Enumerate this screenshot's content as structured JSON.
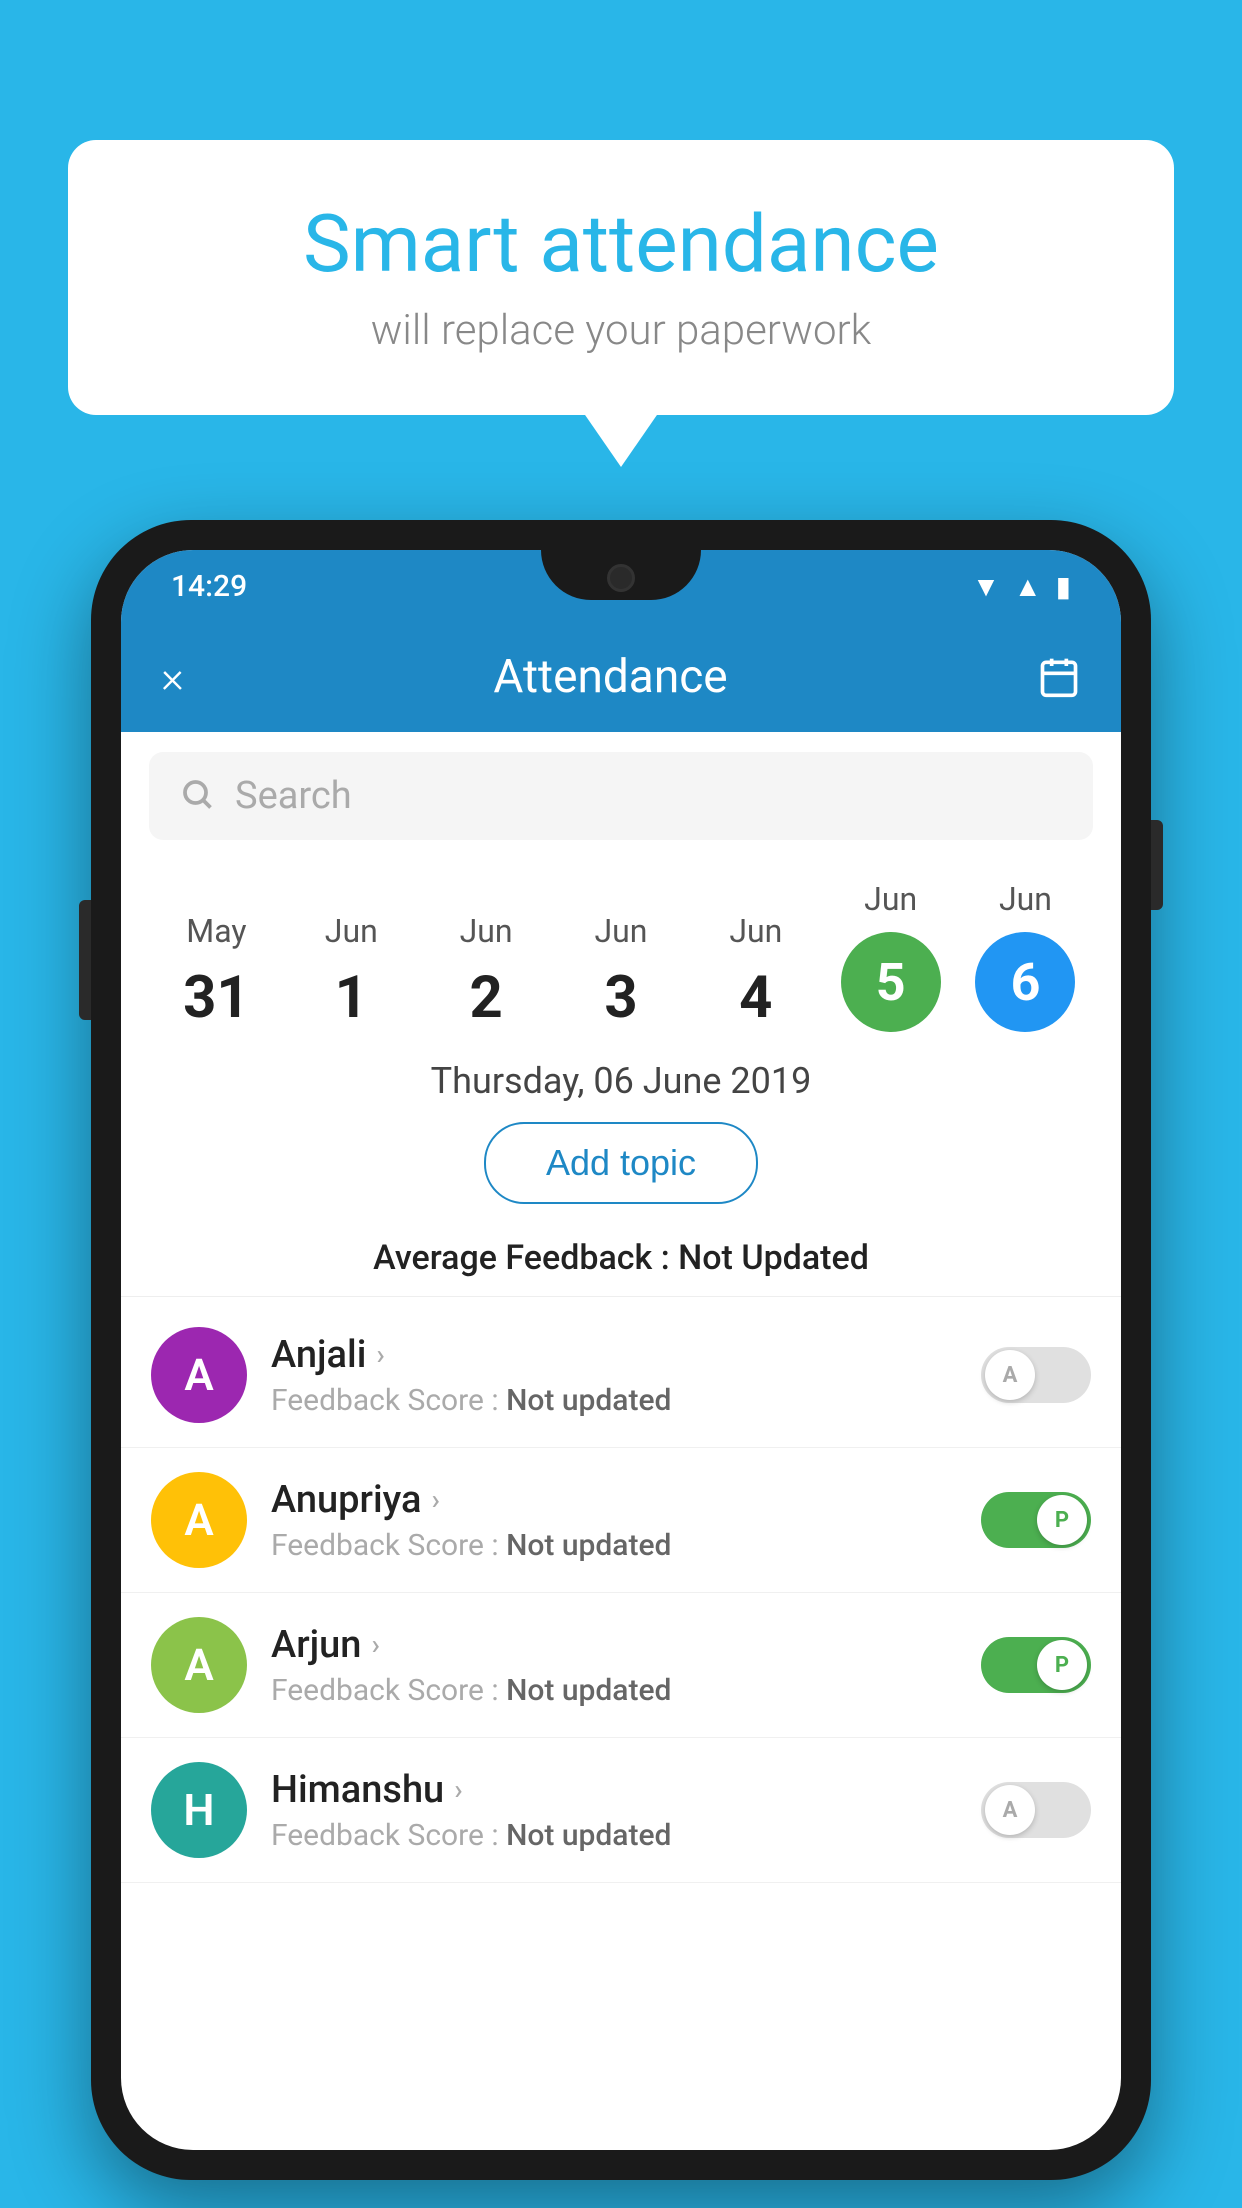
{
  "background_color": "#29b6e8",
  "bubble": {
    "title": "Smart attendance",
    "subtitle": "will replace your paperwork"
  },
  "status_bar": {
    "time": "14:29",
    "wifi": "▼",
    "signal": "▲",
    "battery": "▮"
  },
  "app_bar": {
    "close_label": "×",
    "title": "Attendance",
    "calendar_icon": "calendar-icon"
  },
  "search": {
    "placeholder": "Search"
  },
  "dates": [
    {
      "month": "May",
      "day": "31",
      "selected": false
    },
    {
      "month": "Jun",
      "day": "1",
      "selected": false
    },
    {
      "month": "Jun",
      "day": "2",
      "selected": false
    },
    {
      "month": "Jun",
      "day": "3",
      "selected": false
    },
    {
      "month": "Jun",
      "day": "4",
      "selected": false
    },
    {
      "month": "Jun",
      "day": "5",
      "selected": "green"
    },
    {
      "month": "Jun",
      "day": "6",
      "selected": "blue"
    }
  ],
  "selected_date_label": "Thursday, 06 June 2019",
  "add_topic_label": "Add topic",
  "avg_feedback_label": "Average Feedback :",
  "avg_feedback_value": "Not Updated",
  "students": [
    {
      "name": "Anjali",
      "initial": "A",
      "avatar_color": "purple",
      "feedback_label": "Feedback Score :",
      "feedback_value": "Not updated",
      "toggle_state": "off",
      "toggle_label": "A"
    },
    {
      "name": "Anupriya",
      "initial": "A",
      "avatar_color": "yellow",
      "feedback_label": "Feedback Score :",
      "feedback_value": "Not updated",
      "toggle_state": "on",
      "toggle_label": "P"
    },
    {
      "name": "Arjun",
      "initial": "A",
      "avatar_color": "green",
      "feedback_label": "Feedback Score :",
      "feedback_value": "Not updated",
      "toggle_state": "on",
      "toggle_label": "P"
    },
    {
      "name": "Himanshu",
      "initial": "H",
      "avatar_color": "teal",
      "feedback_label": "Feedback Score :",
      "feedback_value": "Not updated",
      "toggle_state": "off",
      "toggle_label": "A"
    }
  ]
}
